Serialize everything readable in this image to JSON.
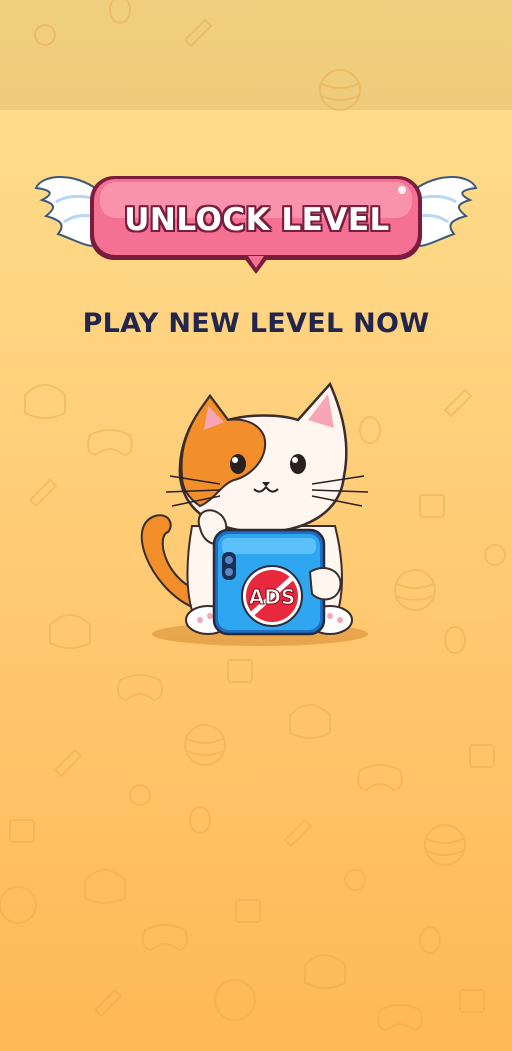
{
  "banner": {
    "title": "UNLOCK LEVEL"
  },
  "subtitle": "PLAY NEW LEVEL NOW",
  "phone_badge": "ADS",
  "colors": {
    "background_top": "#ffe08e",
    "background_bottom": "#ffb955",
    "banner_pink": "#f47194",
    "banner_outline": "#7a1d3c",
    "subtitle": "#23254d",
    "phone_blue": "#2ea7f0",
    "ads_red": "#e8283c"
  },
  "icons": [
    "wings-icon",
    "cat-mascot",
    "phone-icon",
    "ads-badge-icon",
    "toy-doodle-pattern"
  ]
}
